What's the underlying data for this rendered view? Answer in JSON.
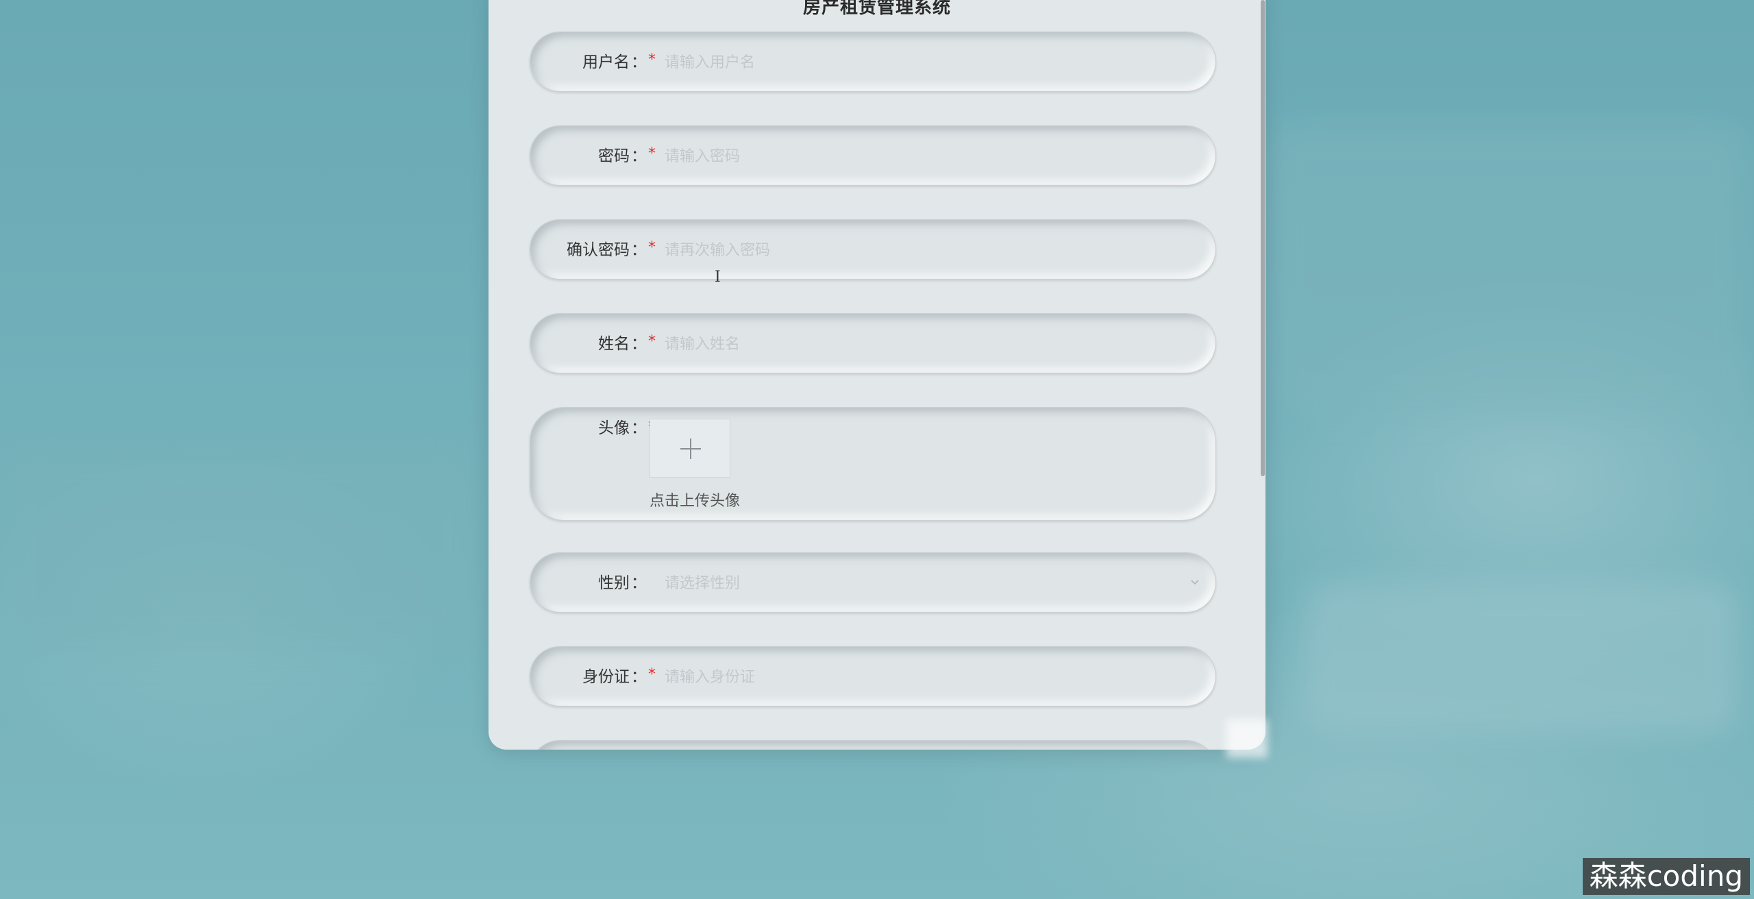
{
  "form": {
    "title": "房产租赁管理系统",
    "fields": {
      "username": {
        "label": "用户名",
        "colon": "：",
        "required": "*",
        "placeholder": "请输入用户名"
      },
      "password": {
        "label": "密码",
        "colon": "：",
        "required": "*",
        "placeholder": "请输入密码"
      },
      "confirm_password": {
        "label": "确认密码",
        "colon": "：",
        "required": "*",
        "placeholder": "请再次输入密码"
      },
      "name": {
        "label": "姓名",
        "colon": "：",
        "required": "*",
        "placeholder": "请输入姓名"
      },
      "avatar": {
        "label": "头像",
        "colon": "：",
        "required": "*",
        "upload_hint": "点击上传头像"
      },
      "gender": {
        "label": "性别",
        "colon": "：",
        "placeholder": "请选择性别"
      },
      "id_card": {
        "label": "身份证",
        "colon": "：",
        "required": "*",
        "placeholder": "请输入身份证"
      }
    }
  },
  "icons": {
    "upload": "plus-icon",
    "select": "chevron-down-icon",
    "cursor": "text-cursor-icon"
  },
  "watermark": "森森coding",
  "colors": {
    "background": "#72b0ba",
    "panel": "#e2e8ea",
    "required": "#e02a2a",
    "placeholder": "#c3c8cb"
  }
}
